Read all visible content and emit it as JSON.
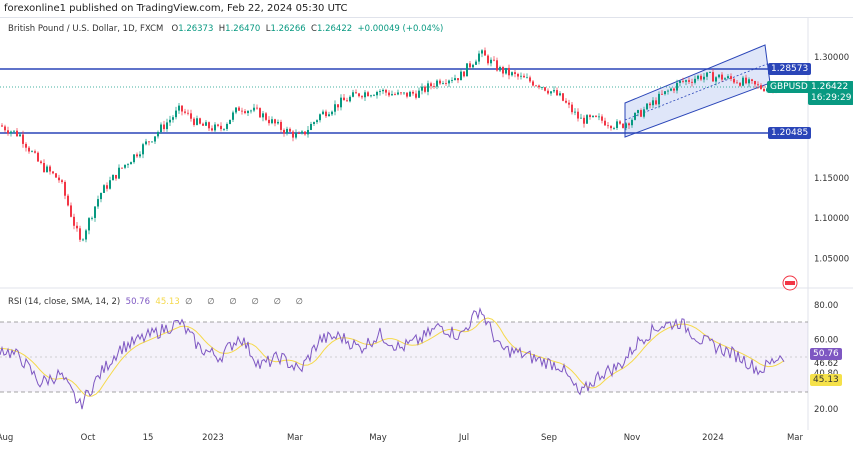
{
  "publisher_line": "forexonline1 published on TradingView.com, Feb 22, 2024 05:30 UTC",
  "legend": {
    "title": "British Pound / U.S. Dollar, 1D, FXCM",
    "o_label": "O",
    "o": "1.26373",
    "h_label": "H",
    "h": "1.26470",
    "l_label": "L",
    "l": "1.26266",
    "c_label": "C",
    "c": "1.26422",
    "change": "+0.00049 (+0.04%)"
  },
  "rsi_legend": {
    "title": "RSI (14, close, SMA, 14, 2)",
    "rsi": "50.76",
    "sma": "45.13",
    "extra_values": [
      "∅",
      "∅",
      "∅",
      "∅",
      "∅",
      "∅"
    ]
  },
  "colors": {
    "up": "#089981",
    "down": "#f23645",
    "level": "#2a45b8",
    "rsi": "#7e57c2",
    "sma": "#f5d94a",
    "channel": "#c9d6f5"
  },
  "labels": {
    "symbol": "GBPUSD",
    "last_price": "1.26422",
    "countdown": "16:29:29",
    "resistance": "1.28573",
    "support": "1.20485",
    "rsi_value": "50.76",
    "rsi_sma": "45.13"
  },
  "chart_data": {
    "type": "candlestick",
    "symbol": "GBPUSD",
    "price_ticks": [
      "1.30000",
      "1.15000",
      "1.10000",
      "1.05000"
    ],
    "price_tick_values": [
      1.3,
      1.15,
      1.1,
      1.05
    ],
    "x_ticks": [
      "Aug",
      "Oct",
      "15",
      "2023",
      "Mar",
      "May",
      "Jul",
      "Sep",
      "Nov",
      "2024",
      "Mar"
    ],
    "horizontal_levels": [
      1.28573,
      1.20485
    ],
    "close_path": [
      1.215,
      1.203,
      1.166,
      1.147,
      1.07,
      1.13,
      1.16,
      1.185,
      1.21,
      1.235,
      1.215,
      1.21,
      1.238,
      1.23,
      1.212,
      1.2,
      1.228,
      1.243,
      1.255,
      1.258,
      1.252,
      1.256,
      1.272,
      1.276,
      1.305,
      1.284,
      1.274,
      1.266,
      1.25,
      1.222,
      1.222,
      1.214,
      1.23,
      1.25,
      1.268,
      1.276,
      1.275,
      1.27,
      1.262,
      1.2642
    ],
    "rsi": {
      "ticks": [
        "80.00",
        "60.00",
        "46.62",
        "40.80",
        "20.00"
      ],
      "tick_values": [
        80,
        60,
        46.62,
        40.8,
        20
      ],
      "upper_band": 70,
      "lower_band": 30,
      "values": [
        55,
        50,
        35,
        40,
        22,
        40,
        55,
        60,
        65,
        70,
        55,
        50,
        62,
        45,
        50,
        42,
        60,
        62,
        55,
        63,
        55,
        60,
        68,
        62,
        78,
        55,
        52,
        48,
        45,
        28,
        40,
        45,
        60,
        68,
        70,
        60,
        55,
        50,
        42,
        50.76
      ]
    }
  }
}
